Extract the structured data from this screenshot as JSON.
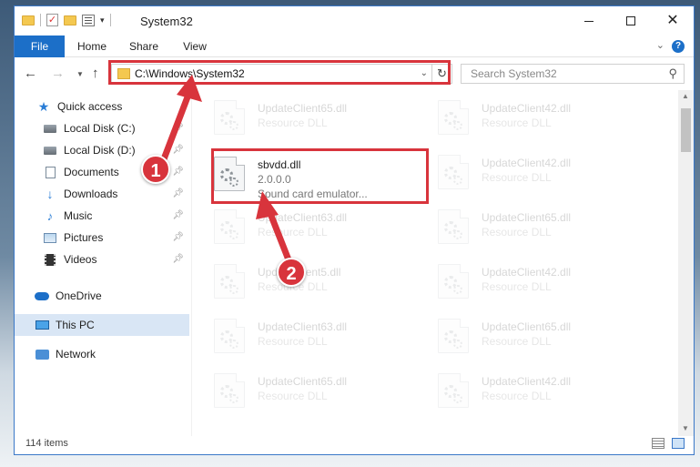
{
  "window": {
    "title": "System32",
    "controls": {
      "minimize": "",
      "maximize": "",
      "close": "✕"
    }
  },
  "ribbon": {
    "tabs": [
      "File",
      "Home",
      "Share",
      "View"
    ]
  },
  "nav": {
    "address_path": "C:\\Windows\\System32",
    "search_placeholder": "Search System32"
  },
  "sidebar": {
    "items": [
      {
        "label": "Quick access",
        "icon": "star-icon",
        "pinned": false
      },
      {
        "label": "Local Disk (C:)",
        "icon": "disk-icon",
        "pinned": true
      },
      {
        "label": "Local Disk (D:)",
        "icon": "disk-icon",
        "pinned": true
      },
      {
        "label": "Documents",
        "icon": "document-icon",
        "pinned": true
      },
      {
        "label": "Downloads",
        "icon": "download-icon",
        "pinned": true
      },
      {
        "label": "Music",
        "icon": "music-icon",
        "pinned": true
      },
      {
        "label": "Pictures",
        "icon": "pictures-icon",
        "pinned": true
      },
      {
        "label": "Videos",
        "icon": "video-icon",
        "pinned": true
      },
      {
        "label": "OneDrive",
        "icon": "cloud-icon",
        "pinned": false
      },
      {
        "label": "This PC",
        "icon": "computer-icon",
        "pinned": false,
        "selected": true
      },
      {
        "label": "Network",
        "icon": "network-icon",
        "pinned": false
      }
    ]
  },
  "files": {
    "left": [
      {
        "name": "UpdateClient65.dll",
        "type": "Resource DLL"
      },
      {
        "name": "sbvdd.dll",
        "version": "2.0.0.0",
        "type": "Sound card emulator..."
      },
      {
        "name": "UpdateClient63.dll",
        "type": "Resource DLL"
      },
      {
        "name": "UpdateClient5.dll",
        "type": "Resource DLL"
      },
      {
        "name": "UpdateClient63.dll",
        "type": "Resource DLL"
      },
      {
        "name": "UpdateClient65.dll",
        "type": "Resource DLL"
      }
    ],
    "right": [
      {
        "name": "UpdateClient42.dll",
        "type": "Resource DLL"
      },
      {
        "name": "UpdateClient42.dll",
        "type": "Resource DLL"
      },
      {
        "name": "UpdateClient65.dll",
        "type": "Resource DLL"
      },
      {
        "name": "UpdateClient42.dll",
        "type": "Resource DLL"
      },
      {
        "name": "UpdateClient65.dll",
        "type": "Resource DLL"
      },
      {
        "name": "UpdateClient42.dll",
        "type": "Resource DLL"
      }
    ]
  },
  "status": {
    "item_count": "114 items"
  },
  "annotations": {
    "step1": "1",
    "step2": "2"
  },
  "colors": {
    "accent": "#1c6fc8",
    "callout": "#d8343c"
  }
}
